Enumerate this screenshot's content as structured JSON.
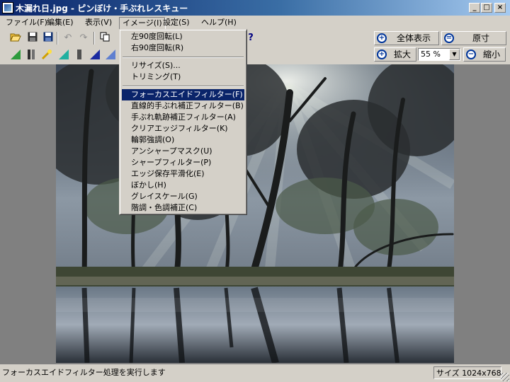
{
  "window": {
    "title": "木漏れ日.jpg - ピンぼけ・手ぶれレスキュー",
    "minimize": "_",
    "maximize": "□",
    "close": "×"
  },
  "menubar": [
    "ファイル(F)",
    "編集(E)",
    "表示(V)",
    "イメージ(I)",
    "設定(S)",
    "ヘルプ(H)"
  ],
  "toolbar": {
    "help_glyph": "?"
  },
  "view_controls": {
    "fit_label": "全体表示",
    "actual_label": "原寸",
    "zoom_in_label": "拡大",
    "zoom_out_label": "縮小",
    "zoom_value": "55 %"
  },
  "image_menu": {
    "group1": [
      "左90度回転(L)",
      "右90度回転(R)"
    ],
    "group2": [
      "リサイズ(S)...",
      "トリミング(T)"
    ],
    "group3": [
      "フォーカスエイドフィルター(F)",
      "直線的手ぶれ補正フィルター(B)",
      "手ぶれ軌跡補正フィルター(A)",
      "クリアエッジフィルター(K)",
      "輪郭強調(O)",
      "アンシャープマスク(U)",
      "シャープフィルター(P)",
      "エッジ保存平滑化(E)",
      "ぼかし(H)",
      "グレイスケール(G)",
      "階調・色調補正(C)"
    ],
    "highlighted": "フォーカスエイドフィルター(F)"
  },
  "status": {
    "message": "フォーカスエイドフィルター処理を実行します",
    "size": "サイズ 1024x768"
  },
  "colors": {
    "title_start": "#0a246a",
    "title_end": "#a6caf0",
    "menu_highlight": "#0a246a",
    "face": "#d4d0c8"
  }
}
